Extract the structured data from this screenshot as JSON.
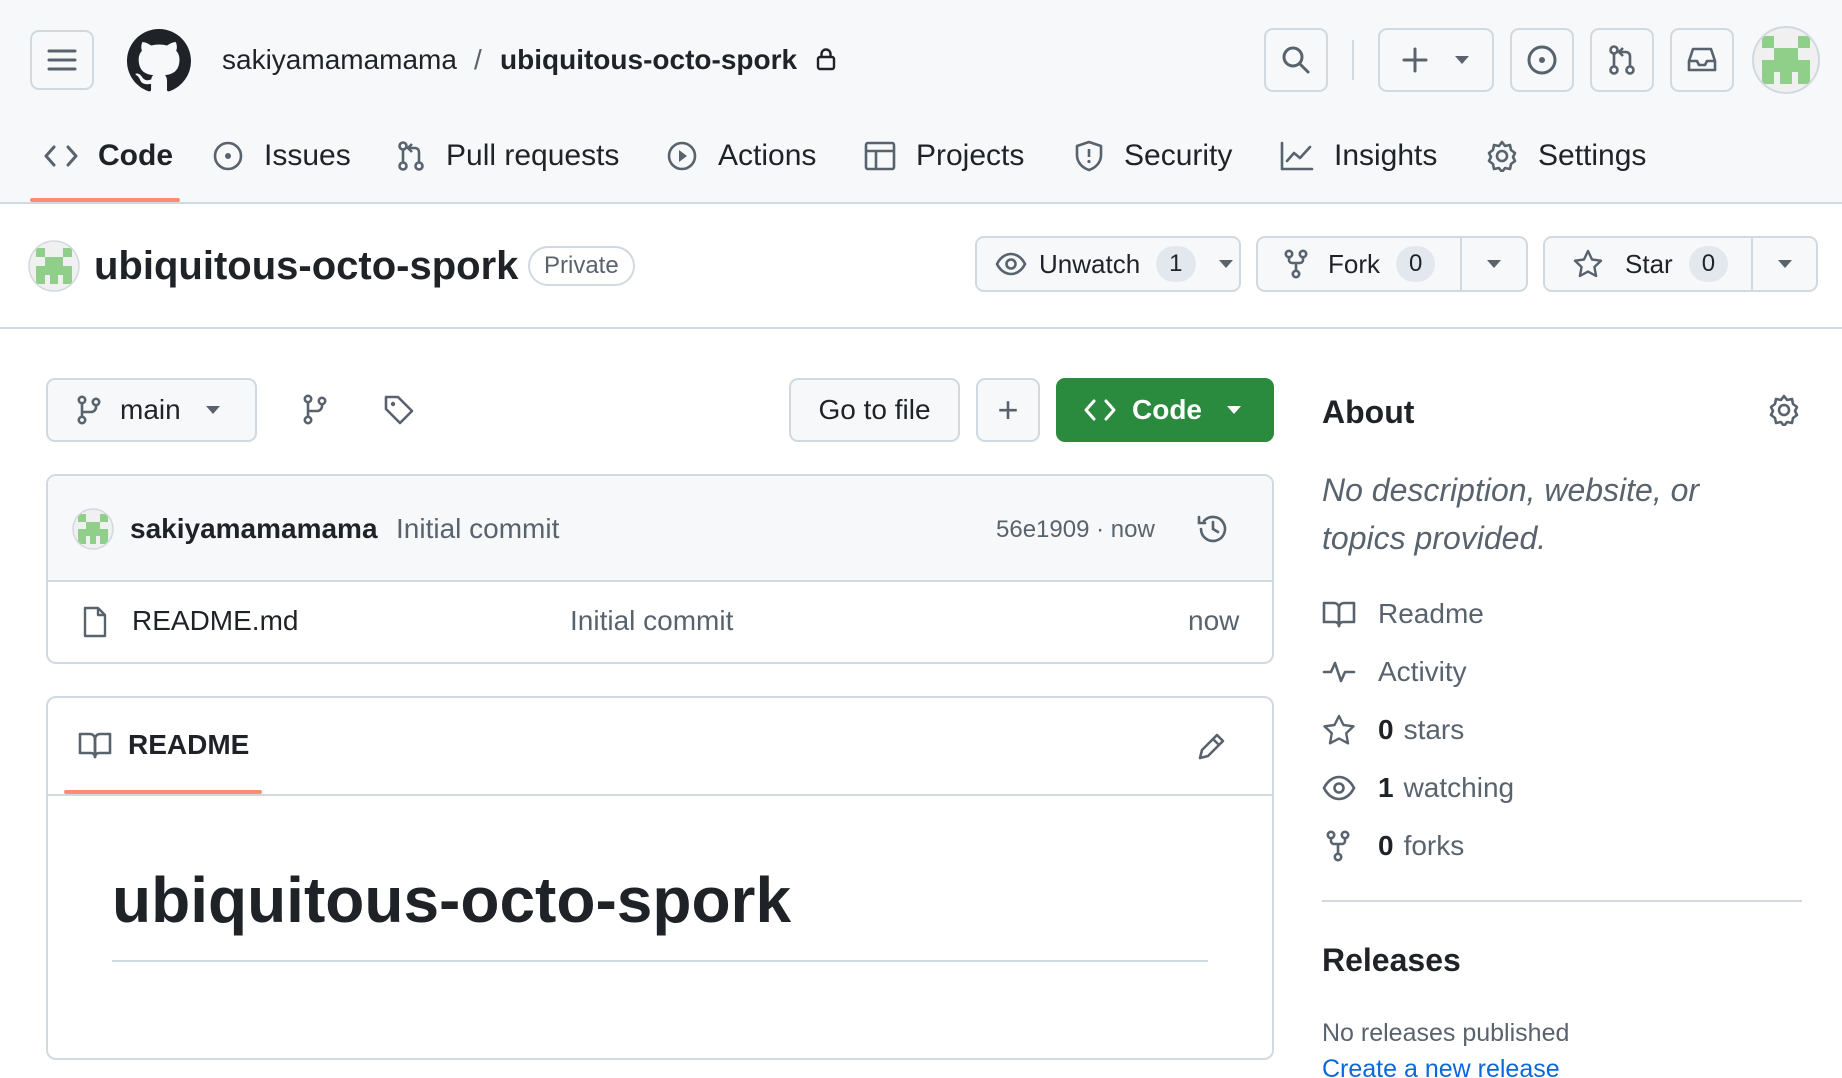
{
  "colors": {
    "accent": "#fd8c73",
    "green": "#2a8a3e",
    "link": "#0969da",
    "muted": "#59636e",
    "border": "#d1d9e0"
  },
  "header": {
    "owner": "sakiyamamamama",
    "separator": "/",
    "repo": "ubiquitous-octo-spork",
    "icons": [
      "menu-icon",
      "github-logo-icon",
      "lock-icon",
      "search-icon",
      "plus-icon",
      "issue-icon",
      "pull-request-icon",
      "inbox-icon",
      "avatar"
    ]
  },
  "tabs": [
    {
      "label": "Code",
      "icon": "code-icon",
      "selected": true
    },
    {
      "label": "Issues",
      "icon": "issue-icon"
    },
    {
      "label": "Pull requests",
      "icon": "pull-request-icon"
    },
    {
      "label": "Actions",
      "icon": "play-icon"
    },
    {
      "label": "Projects",
      "icon": "table-icon"
    },
    {
      "label": "Security",
      "icon": "shield-icon"
    },
    {
      "label": "Insights",
      "icon": "graph-icon"
    },
    {
      "label": "Settings",
      "icon": "gear-icon"
    }
  ],
  "repo_header": {
    "name": "ubiquitous-octo-spork",
    "visibility": "Private",
    "watch": {
      "label": "Unwatch",
      "count": "1"
    },
    "fork": {
      "label": "Fork",
      "count": "0"
    },
    "star": {
      "label": "Star",
      "count": "0"
    }
  },
  "toolbar": {
    "branch": "main",
    "go_to_file": "Go to file",
    "add": "+",
    "code": "Code"
  },
  "latest_commit": {
    "author": "sakiyamamamama",
    "message": "Initial commit",
    "hash_time": "56e1909 · now"
  },
  "files": [
    {
      "name": "README.md",
      "message": "Initial commit",
      "time": "now"
    }
  ],
  "readme": {
    "tab_label": "README",
    "heading": "ubiquitous-octo-spork"
  },
  "about": {
    "title": "About",
    "description": "No description, website, or topics provided.",
    "items": [
      {
        "icon": "book-icon",
        "count": "",
        "label": "Readme"
      },
      {
        "icon": "pulse-icon",
        "count": "",
        "label": "Activity"
      },
      {
        "icon": "star-icon",
        "count": "0",
        "label": "stars"
      },
      {
        "icon": "eye-icon",
        "count": "1",
        "label": "watching"
      },
      {
        "icon": "fork-icon",
        "count": "0",
        "label": "forks"
      }
    ]
  },
  "releases": {
    "title": "Releases",
    "empty": "No releases published",
    "create_link": "Create a new release"
  }
}
